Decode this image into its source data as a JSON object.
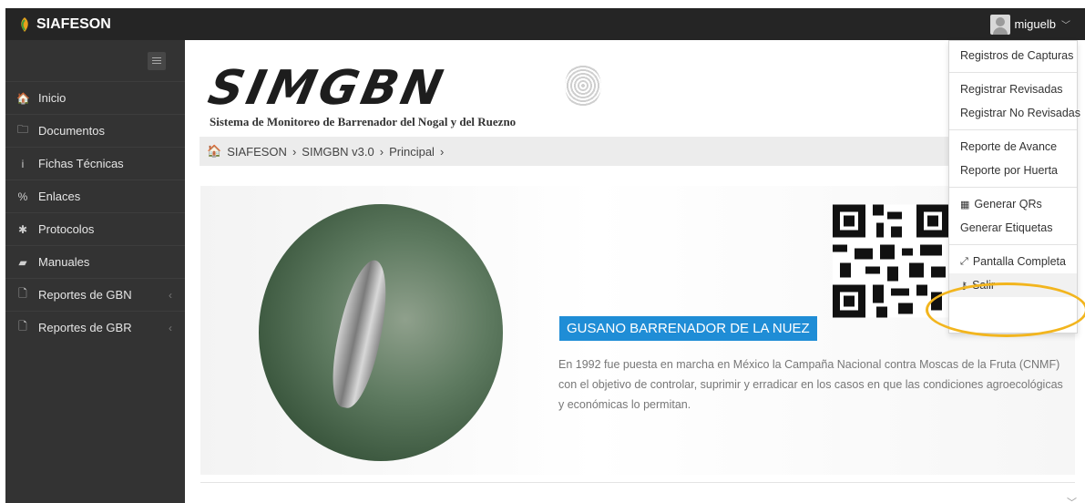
{
  "brand": {
    "name": "SIAFESON"
  },
  "user": {
    "name": "miguelb"
  },
  "sidebar": {
    "items": [
      {
        "label": "Inicio",
        "icon": "home-icon",
        "glyph": "🏠"
      },
      {
        "label": "Documentos",
        "icon": "folder-icon",
        "glyph": "🗀"
      },
      {
        "label": "Fichas Técnicas",
        "icon": "info-icon",
        "glyph": "i"
      },
      {
        "label": "Enlaces",
        "icon": "link-icon",
        "glyph": "%"
      },
      {
        "label": "Protocolos",
        "icon": "gear-icon",
        "glyph": "✱"
      },
      {
        "label": "Manuales",
        "icon": "book-icon",
        "glyph": "▰"
      },
      {
        "label": "Reportes de GBN",
        "icon": "file-icon",
        "glyph": "🗋"
      },
      {
        "label": "Reportes de GBR",
        "icon": "file-icon",
        "glyph": "🗋"
      }
    ]
  },
  "logo": {
    "title": "SIMGBN",
    "subtitle": "Sistema de Monitoreo de Barrenador del Nogal y del Ruezno"
  },
  "breadcrumb": {
    "items": [
      "SIAFESON",
      "SIMGBN v3.0",
      "Principal"
    ]
  },
  "banner": {
    "title": "GUSANO BARRENADOR DE LA NUEZ",
    "text": "En 1992 fue puesta en marcha en México la Campaña Nacional contra Moscas de la Fruta (CNMF) con el objetivo de controlar, suprimir y erradicar en los casos en que las condiciones agroecológicas y económicas lo permitan."
  },
  "dropdown": {
    "registros": "Registros de Capturas",
    "registrar_revisadas": "Registrar Revisadas",
    "registrar_no_revisadas": "Registrar No Revisadas",
    "reporte_avance": "Reporte de Avance",
    "reporte_huerta": "Reporte por Huerta",
    "generar_qrs": "Generar QRs",
    "generar_etiquetas": "Generar Etiquetas",
    "pantalla_completa": "Pantalla Completa",
    "salir": "Salir"
  },
  "colors": {
    "topbar": "#252525",
    "sidebar": "#333333",
    "accent": "#1f8dd6",
    "highlight": "#f2b51e"
  }
}
